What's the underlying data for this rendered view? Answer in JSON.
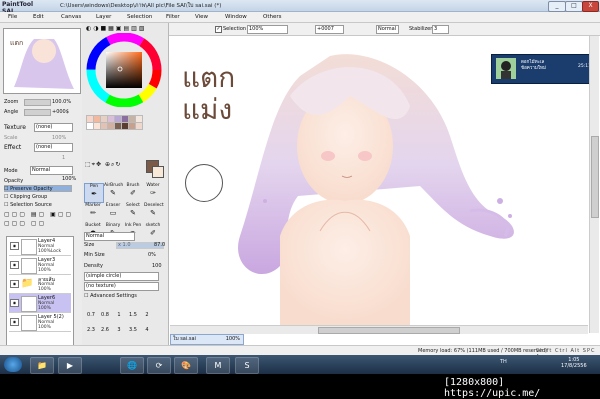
{
  "app": {
    "logo": "PaintTool SAI",
    "title": "C:\\Users\\windows\\Desktop\\ภาพ\\All pic\\File SAI\\ใบ sai.sai (*)",
    "win_buttons": [
      "_",
      "□",
      "X"
    ]
  },
  "menu": [
    "File",
    "Edit",
    "Canvas",
    "Layer",
    "Selection",
    "Filter",
    "View",
    "Window",
    "Others"
  ],
  "toolbar": {
    "selection_label": "Selection",
    "zoom": "100%",
    "angle": "+0007",
    "mode": "Normal",
    "stabilizer_label": "Stabilizer",
    "stabilizer": "3"
  },
  "left": {
    "zoom_label": "Zoom",
    "zoom_value": "100.0%",
    "angle_label": "Angle",
    "angle_value": "+000$",
    "texture_label": "Texture",
    "texture_value": "(none)",
    "scale_label": "Scale",
    "scale_value": "100%",
    "effect_label": "Effect",
    "effect_value": "(none)",
    "width_value": "1",
    "mode_label": "Mode",
    "mode_value": "Normal",
    "opacity_label": "Opacity",
    "opacity_value": "100%",
    "checks": [
      "Preserve Opacity",
      "Clipping Group",
      "Selection Source"
    ],
    "layers": [
      {
        "name": "Layer4",
        "mode": "Normal",
        "opacity": "100%Lock"
      },
      {
        "name": "Layer3",
        "mode": "Normal",
        "opacity": "100%"
      },
      {
        "name": "ลายเส้น",
        "mode": "Normal",
        "opacity": "100%"
      },
      {
        "name": "Layer6",
        "mode": "Normal",
        "opacity": "100%"
      },
      {
        "name": "Layer 5(2)",
        "mode": "Normal",
        "opacity": "100%"
      }
    ]
  },
  "tools": {
    "names": [
      "Pen",
      "AirBrush",
      "Brush",
      "Water",
      "Marker",
      "Eraser",
      "Select",
      "Deselect",
      "Bucket",
      "Binary",
      "Ink Pen",
      "sketch"
    ],
    "brush_mode": "Normal",
    "size_label": "Size",
    "size_mult": "x 1.0",
    "size_value": "87.0",
    "minsize_label": "Min Size",
    "minsize_value": "0%",
    "density_label": "Density",
    "density_value": "100",
    "shape": "(simple circle)",
    "texture": "(no texture)",
    "advanced": "Advanced Settings",
    "size_presets": [
      "0.7",
      "0.8",
      "1",
      "1.5",
      "2",
      "2.3",
      "2.6",
      "3",
      "3.5",
      "4"
    ]
  },
  "palette_colors": [
    "#f7d6c9",
    "#f2b9a0",
    "#e8cfc4",
    "#d9c0d8",
    "#b9a7d6",
    "#8a6f9e",
    "#c7b3a5",
    "#f3e6df",
    "#ffffff",
    "#fbe3d6",
    "#e4c2b3",
    "#d2b0a2",
    "#7c6052",
    "#5a3e32",
    "#c8a18e",
    "#efd7cc"
  ],
  "fg_color": "#7b5a48",
  "canvas": {
    "handwriting": [
      "แตก",
      "แม่ง"
    ]
  },
  "notification": {
    "title": "ดอกไม้ทะเล",
    "text": "ข้อความใหม่",
    "time": "25:11"
  },
  "doc_tab": {
    "name": "ใบ sai.sai",
    "zoom": "100%"
  },
  "status": {
    "memory": "Memory load: 67% (111MB used / 700MB reserved)",
    "keys": "Shift Ctrl Alt SPC Any"
  },
  "taskbar": {
    "icons": [
      "📁",
      "▶",
      "🌐",
      "⟳",
      "🎨",
      "M",
      "S"
    ],
    "lang": "TH",
    "time": "1:05",
    "date": "17/8/2556"
  },
  "watermark": "[1280x800] https://upic.me/"
}
